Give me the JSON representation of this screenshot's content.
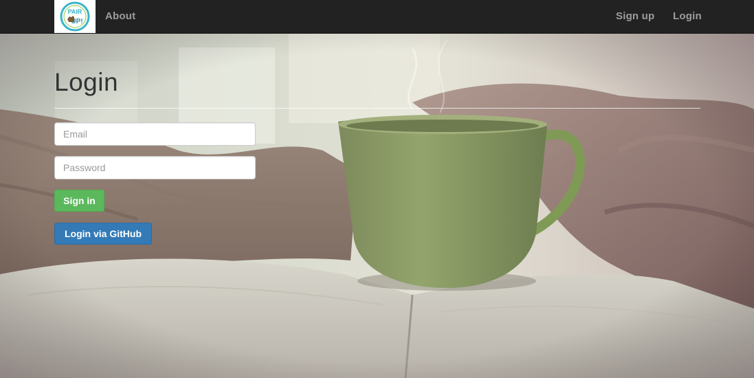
{
  "navbar": {
    "logo_text_top": "PAIR",
    "logo_text_bottom": "UP!",
    "about_label": "About",
    "signup_label": "Sign up",
    "login_label": "Login"
  },
  "main": {
    "title": "Login",
    "email_placeholder": "Email",
    "password_placeholder": "Password",
    "signin_label": "Sign in",
    "github_label": "Login via GitHub"
  },
  "colors": {
    "navbar_bg": "#222222",
    "nav_link": "#9d9d9d",
    "success": "#5cb85c",
    "primary": "#337ab7"
  }
}
